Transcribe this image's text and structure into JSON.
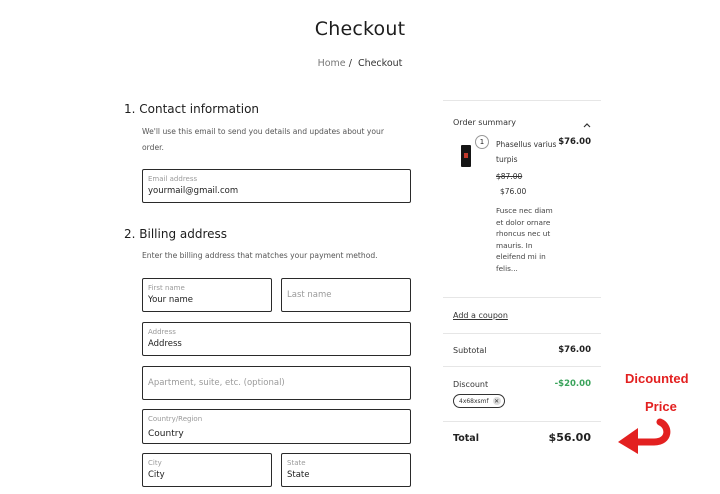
{
  "page": {
    "title": "Checkout"
  },
  "breadcrumb": {
    "home": "Home",
    "separator": "/",
    "current": "Checkout"
  },
  "contact": {
    "heading": "1.  Contact information",
    "description": "We'll use this email to send you details and updates about your order.",
    "email": {
      "label": "Email address",
      "value": "yourmail@gmail.com"
    }
  },
  "billing": {
    "heading": "2.  Billing address",
    "description": "Enter the billing address that matches your payment method.",
    "first_name": {
      "label": "First name",
      "value": "Your name"
    },
    "last_name": {
      "placeholder": "Last name"
    },
    "address": {
      "label": "Address",
      "value": "Address"
    },
    "apartment": {
      "placeholder": "Apartment, suite, etc. (optional)"
    },
    "country": {
      "label": "Country/Region",
      "value": "Country"
    },
    "city": {
      "label": "City",
      "value": "City"
    },
    "state": {
      "label": "State",
      "value": "State"
    }
  },
  "summary": {
    "heading": "Order summary",
    "item": {
      "quantity": "1",
      "name": "Phasellus varius turpis",
      "price": "$76.00",
      "original_price": "$87.00",
      "sale_price": "$76.00",
      "description": "Fusce nec diam et dolor ornare rhoncus nec ut mauris. In eleifend mi in felis..."
    },
    "coupon_link": "Add a coupon",
    "subtotal_label": "Subtotal",
    "subtotal_value": "$76.00",
    "discount_label": "Discount",
    "discount_value": "-$20.00",
    "coupon_code": "4x68xsmf",
    "total_label": "Total",
    "total_value": "$56.00"
  },
  "annotation": {
    "line1": "Dicounted",
    "line2": "Price",
    "color": "#e32020"
  }
}
